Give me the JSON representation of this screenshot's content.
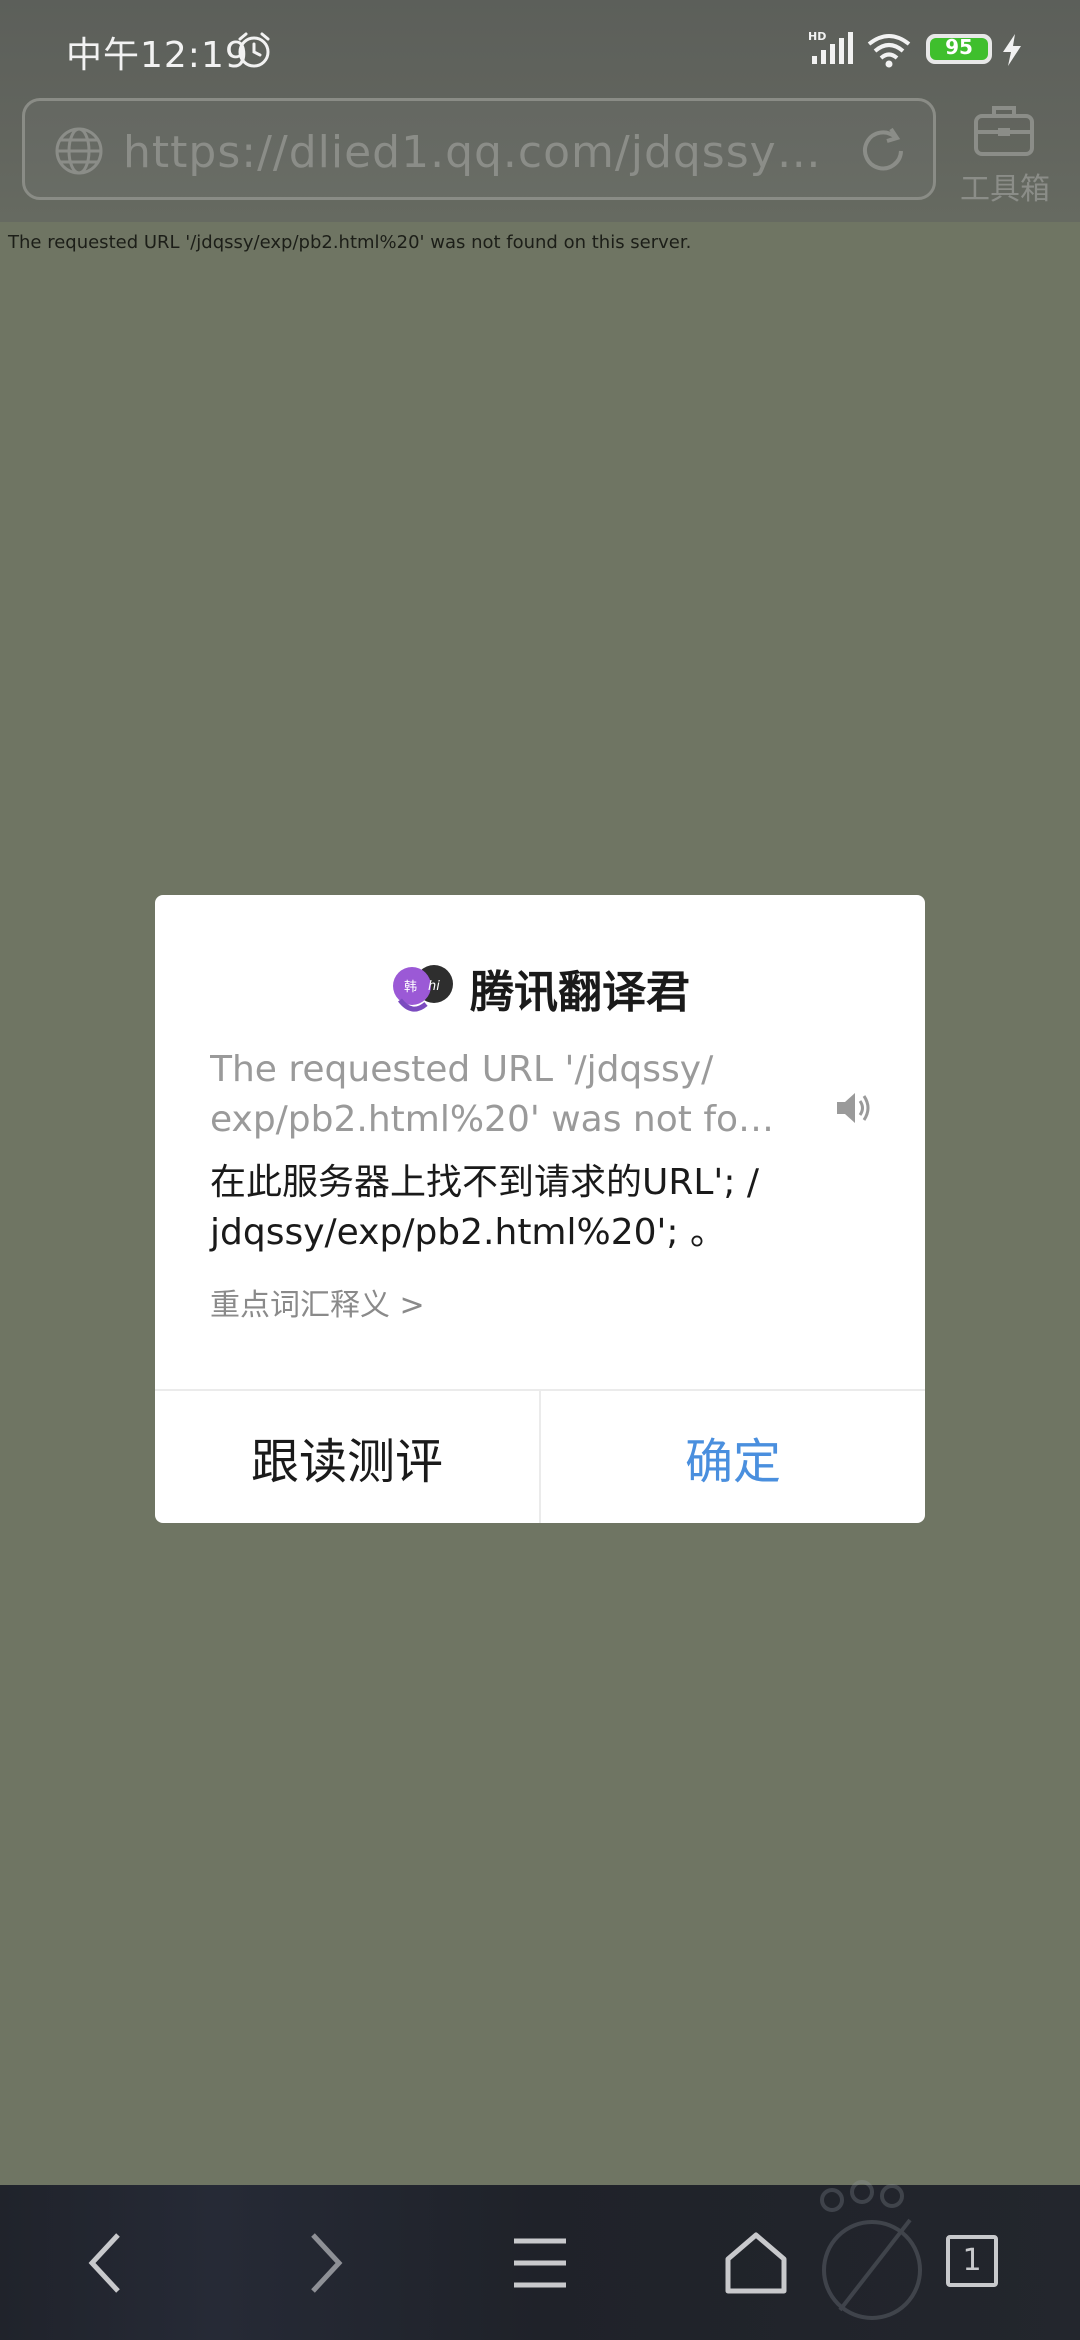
{
  "status_bar": {
    "time": "中午12:19",
    "battery_level": "95",
    "network": "HD"
  },
  "browser": {
    "url": "https://dlied1.qq.com/jdqssy…",
    "toolbox_label": "工具箱"
  },
  "page": {
    "error_message": "The requested URL '/jdqssy/exp/pb2.html%20' was not found on this server."
  },
  "dialog": {
    "title": "腾讯翻译君",
    "source_line1": "The requested URL '/jdqssy/",
    "source_line2": "exp/pb2.html%20' was not fo…",
    "translation_line1": "在此服务器上找不到请求的URL'; /",
    "translation_line2": "jdqssy/exp/pb2.html%20'; 。",
    "vocab_link": "重点词汇释义 >",
    "left_button": "跟读测评",
    "right_button": "确定",
    "accent_color": "#4a8fde"
  },
  "bottom_nav": {
    "tab_count": "1",
    "icons": [
      "back-icon",
      "forward-icon",
      "menu-icon",
      "home-icon",
      "tabs-icon"
    ]
  }
}
